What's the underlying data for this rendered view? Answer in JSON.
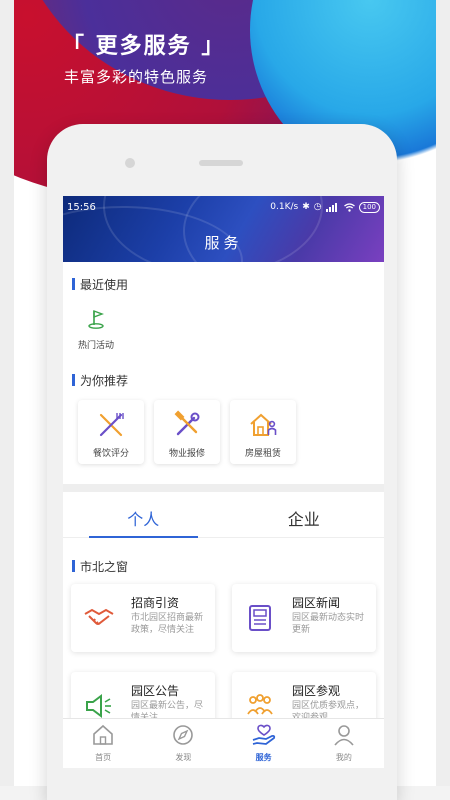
{
  "promo": {
    "title": "「 更多服务 」",
    "subtitle": "丰富多彩的特色服务"
  },
  "status_bar": {
    "time": "15:56",
    "network_speed": "0.1K/s",
    "battery": "100",
    "icons": [
      "bluetooth-icon",
      "alarm-icon",
      "signal-icon",
      "wifi-icon",
      "battery-icon"
    ]
  },
  "header": {
    "title": "服务"
  },
  "recent": {
    "title": "最近使用",
    "items": [
      {
        "label": "热门活动",
        "icon": "flag-icon"
      }
    ]
  },
  "recommend": {
    "title": "为你推荐",
    "items": [
      {
        "label": "餐饮评分",
        "icon": "fork-knife-icon"
      },
      {
        "label": "物业报修",
        "icon": "wrench-hammer-icon"
      },
      {
        "label": "房屋租赁",
        "icon": "house-person-icon"
      }
    ]
  },
  "tabs": [
    {
      "label": "个人",
      "active": true
    },
    {
      "label": "企业",
      "active": false
    }
  ],
  "window": {
    "title": "市北之窗",
    "cards": [
      {
        "title": "招商引资",
        "desc": "市北园区招商最新政策，尽情关注",
        "icon": "handshake-icon"
      },
      {
        "title": "园区新闻",
        "desc": "园区最新动态实时更新",
        "icon": "newspaper-icon"
      },
      {
        "title": "园区公告",
        "desc": "园区最新公告，尽情关注",
        "icon": "megaphone-icon"
      },
      {
        "title": "园区参观",
        "desc": "园区优质参观点，欢迎参观",
        "icon": "visitors-icon"
      }
    ]
  },
  "bottom_nav": [
    {
      "label": "首页",
      "icon": "home-icon",
      "active": false
    },
    {
      "label": "发现",
      "icon": "compass-icon",
      "active": false
    },
    {
      "label": "服务",
      "icon": "service-hand-icon",
      "active": true
    },
    {
      "label": "我的",
      "icon": "profile-icon",
      "active": false
    }
  ],
  "colors": {
    "accent": "#2f64d6",
    "icon_orange": "#f0a030",
    "icon_purple": "#6a4fc8",
    "icon_green": "#3aa34a",
    "icon_red": "#e05a3a"
  }
}
